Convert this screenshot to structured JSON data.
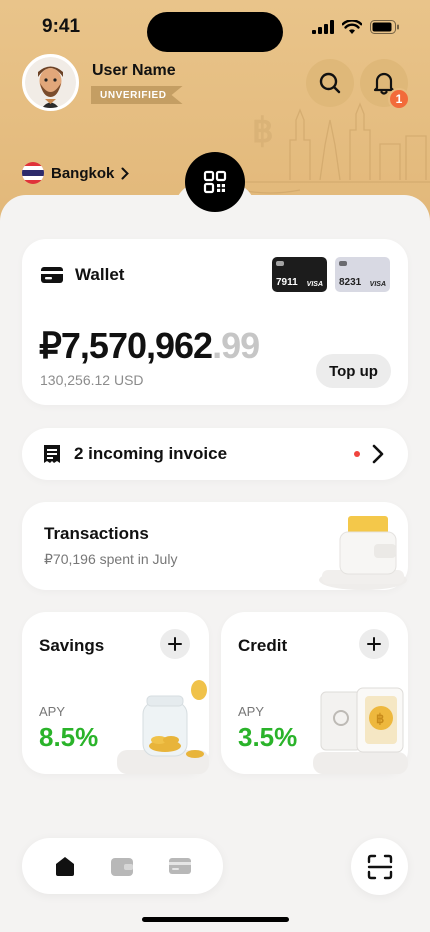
{
  "status_bar": {
    "time": "9:41"
  },
  "user": {
    "name": "User Name",
    "status_badge": "UNVERIFIED"
  },
  "notifications": {
    "count": "1"
  },
  "location": {
    "city": "Bangkok"
  },
  "wallet": {
    "title": "Wallet",
    "cards": [
      {
        "last4": "7911",
        "network": "VISA",
        "style": "dark"
      },
      {
        "last4": "8231",
        "network": "VISA",
        "style": "light"
      }
    ],
    "balance_main": "₽7,570,962",
    "balance_cents": ".99",
    "balance_usd": "130,256.12 USD",
    "topup_label": "Top up"
  },
  "invoice": {
    "label": "2 incoming invoice"
  },
  "transactions": {
    "title": "Transactions",
    "subtitle": "₽70,196 spent in July"
  },
  "savings": {
    "title": "Savings",
    "apy_label": "APY",
    "apy_value": "8.5%"
  },
  "credit": {
    "title": "Credit",
    "apy_label": "APY",
    "apy_value": "3.5%"
  },
  "tabbar": {
    "items": [
      "home-icon",
      "wallet-icon",
      "card-icon"
    ],
    "active": 0
  },
  "colors": {
    "header": "#e6bd80",
    "accent_green": "#2ab32a",
    "notification": "#f26b3a"
  }
}
